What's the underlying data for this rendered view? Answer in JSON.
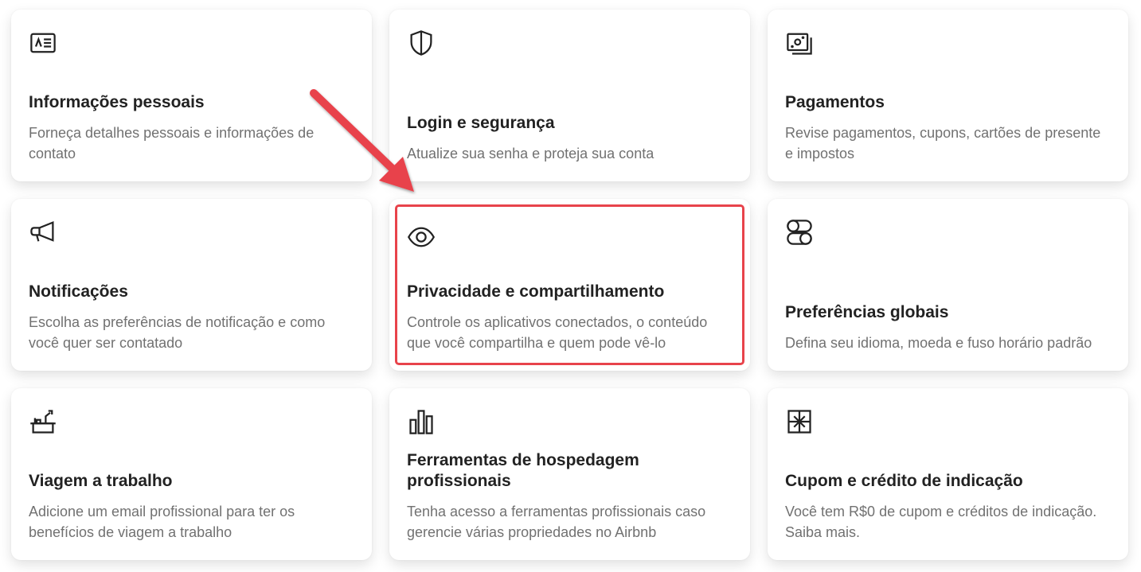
{
  "colors": {
    "highlight": "#e8434b",
    "title": "#222222",
    "description": "#717171"
  },
  "cards": [
    {
      "icon": "id-card-icon",
      "title": "Informações pessoais",
      "description": "Forneça detalhes pessoais e informações de contato"
    },
    {
      "icon": "shield-icon",
      "title": "Login e segurança",
      "description": "Atualize sua senha e proteja sua conta"
    },
    {
      "icon": "payments-icon",
      "title": "Pagamentos",
      "description": "Revise pagamentos, cupons, cartões de presente e impostos"
    },
    {
      "icon": "megaphone-icon",
      "title": "Notificações",
      "description": "Escolha as preferências de notificação e como você quer ser contatado"
    },
    {
      "icon": "eye-icon",
      "title": "Privacidade e compartilhamento",
      "description": "Controle os aplicativos conectados, o conteúdo que você compartilha e quem pode vê-lo"
    },
    {
      "icon": "toggles-icon",
      "title": "Preferências globais",
      "description": "Defina seu idioma, moeda e fuso horário padrão"
    },
    {
      "icon": "desk-icon",
      "title": "Viagem a trabalho",
      "description": "Adicione um email profissional para ter os benefícios de viagem a trabalho"
    },
    {
      "icon": "bar-chart-icon",
      "title": "Ferramentas de hospedagem profissionais",
      "description": "Tenha acesso a ferramentas profissionais caso gerencie várias propriedades no Airbnb"
    },
    {
      "icon": "gift-icon",
      "title": "Cupom e crédito de indicação",
      "description": "Você tem R$0 de cupom e créditos de indicação. Saiba mais."
    }
  ]
}
